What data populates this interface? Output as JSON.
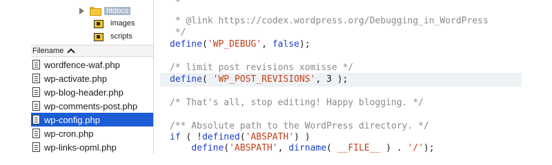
{
  "tree": {
    "folder_selected": "htdocs",
    "folders": [
      "images",
      "scripts"
    ]
  },
  "list_header": {
    "label": "Filename"
  },
  "files": [
    {
      "name": "wordfence-waf.php"
    },
    {
      "name": "wp-activate.php"
    },
    {
      "name": "wp-blog-header.php"
    },
    {
      "name": "wp-comments-post.php"
    },
    {
      "name": "wp-config.php",
      "selected": true
    },
    {
      "name": "wp-cron.php"
    },
    {
      "name": "wp-links-opml.php"
    }
  ],
  "code": {
    "line_0": " *",
    "line_1": " * @link https://codex.wordpress.org/Debugging_in_WordPress",
    "line_2": " */",
    "line_3_fn": "define",
    "line_3_open": "(",
    "line_3_str": "'WP_DEBUG'",
    "line_3_mid": ", ",
    "line_3_kw": "false",
    "line_3_close": ");",
    "line_5": "/* limit post revisions xomisse */",
    "line_6_fn": "define",
    "line_6_open": "( ",
    "line_6_str": "'WP_POST_REVISIONS'",
    "line_6_mid": ", ",
    "line_6_num": "3",
    "line_6_close": " );",
    "line_8": "/* That's all, stop editing! Happy blogging. */",
    "line_10": "/** Absolute path to the WordPress directory. */",
    "line_11_kw": "if",
    "line_11_a": " ( !",
    "line_11_fn": "defined",
    "line_11_b": "(",
    "line_11_str": "'ABSPATH'",
    "line_11_c": ") )",
    "line_12_indent": "    ",
    "line_12_fn": "define",
    "line_12_a": "(",
    "line_12_str": "'ABSPATH'",
    "line_12_b": ", ",
    "line_12_fn2": "dirname",
    "line_12_c": "( ",
    "line_12_const": "__FILE__",
    "line_12_d": " ) . ",
    "line_12_str2": "'/'",
    "line_12_e": ");"
  },
  "colors": {
    "selection": "#1c5cd5",
    "keyword": "#1a3fc8",
    "string": "#c2401a",
    "comment": "#8a8a8a",
    "highlight_line": "#eef2f4"
  }
}
